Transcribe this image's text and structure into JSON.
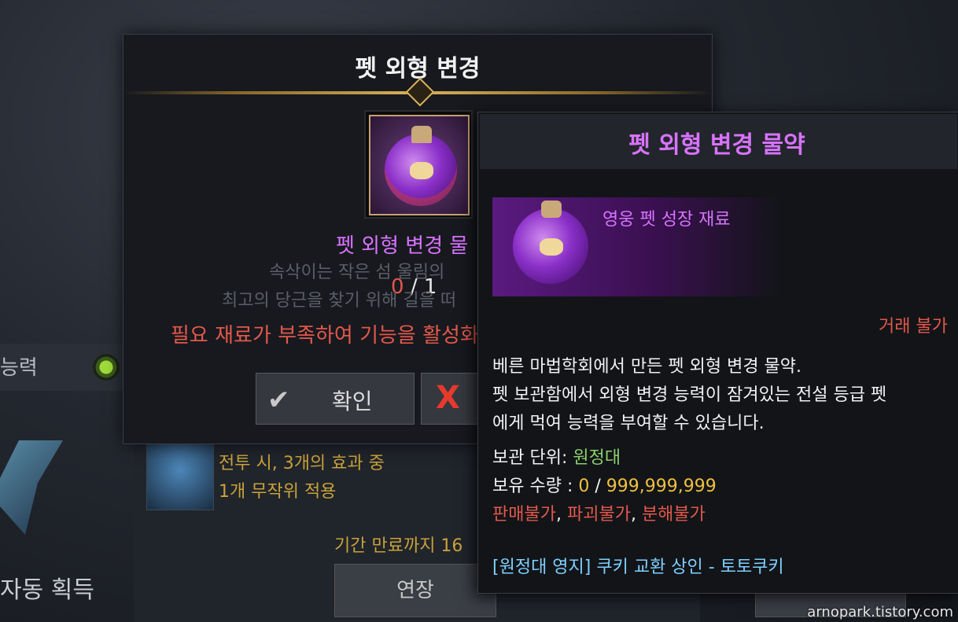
{
  "background": {
    "ability_label": "능력",
    "acquire_label": "자동 획득",
    "skill_text_line1": "전투 시, 3개의 효과 중",
    "skill_text_line2": "1개 무작위 적용",
    "expire_text": "기간 만료까지 16",
    "extend_label": "연장"
  },
  "dialog": {
    "title": "펫 외형 변경",
    "item_name": "펫 외형 변경 물",
    "faded_line1": "속삭이는 작은 섬 울림의",
    "faded_line2": "최고의 당근을 찾기 위해 길을 떠",
    "have": "0",
    "slash": "/",
    "need": "1",
    "warning": "필요 재료가 부족하여 기능을 활성화 할 수 없습니다",
    "confirm_label": "확인",
    "cancel_glyph": "X"
  },
  "tooltip": {
    "title": "펫 외형 변경 물약",
    "grade": "영웅 펫 성장 재료",
    "trade": "거래 불가",
    "desc_lines": [
      "베른 마법학회에서 만든 펫 외형 변경 물약.",
      "펫 보관함에서 외형 변경 능력이 잠겨있는 전설 등급 펫",
      "에게 먹여 능력을 부여할 수 있습니다."
    ],
    "storage_label": "보관 단위: ",
    "storage_value": "원정대",
    "owned_label": "보유 수량 : ",
    "owned_value": "0",
    "owned_sep": " / ",
    "owned_max": "999,999,999",
    "restrict_sell": "판매불가",
    "restrict_destroy": "파괴불가",
    "restrict_disassemble": "분해불가",
    "comma": ", ",
    "source": "[원정대 영지] 쿠키 교환 상인 - 토토쿠키"
  },
  "watermark": "arnopark.tistory.com",
  "colors": {
    "epic_purple": "#d873ff",
    "warning_red": "#e3584b",
    "gold": "#c9a23a",
    "green": "#8bd16a",
    "yellow": "#f0c040",
    "link_blue": "#7fd0ff"
  }
}
